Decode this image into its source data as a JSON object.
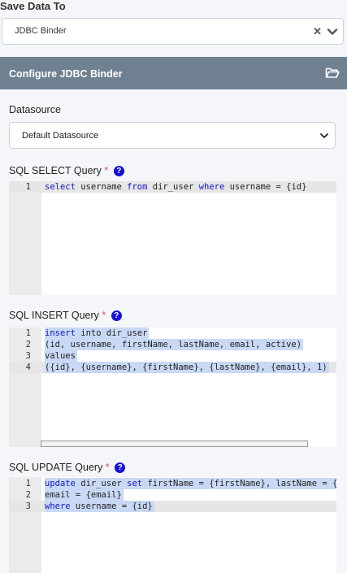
{
  "save_data_to": {
    "label": "Save Data To",
    "selected": "JDBC Binder",
    "clear_symbol": "✕"
  },
  "panel": {
    "title": "Configure JDBC Binder",
    "icon": "folder-open-icon",
    "header_color": "#6f8190"
  },
  "datasource": {
    "label": "Datasource",
    "selected": "Default Datasource"
  },
  "required_mark": "*",
  "help_symbol": "?",
  "select_query": {
    "label": "SQL SELECT Query",
    "lines": [
      {
        "num": "1",
        "html": "<span class=\"kw\">select</span> username <span class=\"kw\">from</span> dir_user <span class=\"kw\">where</span> username = {id}"
      }
    ]
  },
  "insert_query": {
    "label": "SQL INSERT Query",
    "lines": [
      {
        "num": "1",
        "html": "<span class=\"kw\">insert</span> into dir_user"
      },
      {
        "num": "2",
        "html": "(id, username, firstName, lastName, email, active)"
      },
      {
        "num": "3",
        "html": "values"
      },
      {
        "num": "4",
        "html": "({id}, {username}, {firstName}, {lastName}, {email}, 1)"
      }
    ]
  },
  "update_query": {
    "label": "SQL UPDATE Query",
    "lines": [
      {
        "num": "1",
        "html": "<span class=\"kw\">update</span> dir_user <span class=\"kw\">set</span> firstName = {firstName}, lastName = {lastName},"
      },
      {
        "num": "2",
        "html": "email = {email}"
      },
      {
        "num": "3",
        "html": "<span class=\"kw\">where</span> username = {id}"
      }
    ]
  }
}
